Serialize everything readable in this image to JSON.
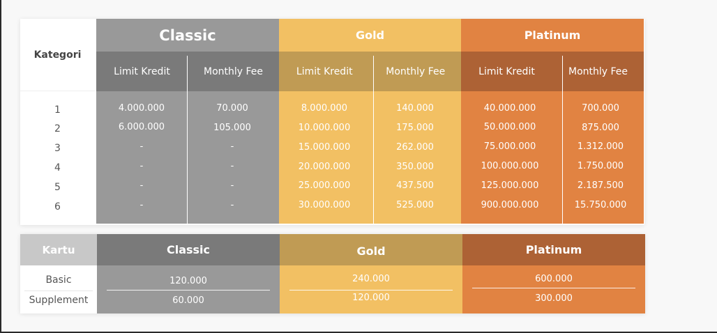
{
  "limit_table": {
    "category_header": "Kategori",
    "rows": [
      "1",
      "2",
      "3",
      "4",
      "5",
      "6"
    ],
    "tiers": [
      {
        "name": "Classic",
        "color": "#999999",
        "sub_color": "#7a7a7a",
        "col1_label": "Limit Kredit",
        "col2_label": "Monthly Fee",
        "limit": [
          "4.000.000",
          "6.000.000",
          "-",
          "-",
          "-",
          "-"
        ],
        "fee": [
          "70.000",
          "105.000",
          "-",
          "-",
          "-",
          "-"
        ]
      },
      {
        "name": "Gold",
        "color": "#f2c063",
        "sub_color": "#c09b54",
        "col1_label": "Limit Kredit",
        "col2_label": "Monthly Fee",
        "limit": [
          "8.000.000",
          "10.000.000",
          "15.000.000",
          "20.000.000",
          "25.000.000",
          "30.000.000"
        ],
        "fee": [
          "140.000",
          "175.000",
          "262.000",
          "350.000",
          "437.500",
          "525.000"
        ]
      },
      {
        "name": "Platinum",
        "color": "#e18342",
        "sub_color": "#ad6235",
        "col1_label": "Limit Kredit",
        "col2_label": "Monthly Fee",
        "limit": [
          "40.000.000",
          "50.000.000",
          "75.000.000",
          "100.000.000",
          "125.000.000",
          "900.000.000"
        ],
        "fee": [
          "700.000",
          "875.000",
          "1.312.000",
          "1.750.000",
          "2.187.500",
          "15.750.000"
        ]
      }
    ]
  },
  "card_table": {
    "header": "Kartu",
    "rows": [
      "Basic",
      "Supplement"
    ],
    "tiers": [
      {
        "name": "Classic",
        "basic": "120.000",
        "supplement": "60.000"
      },
      {
        "name": "Gold",
        "basic": "240.000",
        "supplement": "120.000"
      },
      {
        "name": "Platinum",
        "basic": "600.000",
        "supplement": "300.000"
      }
    ]
  }
}
